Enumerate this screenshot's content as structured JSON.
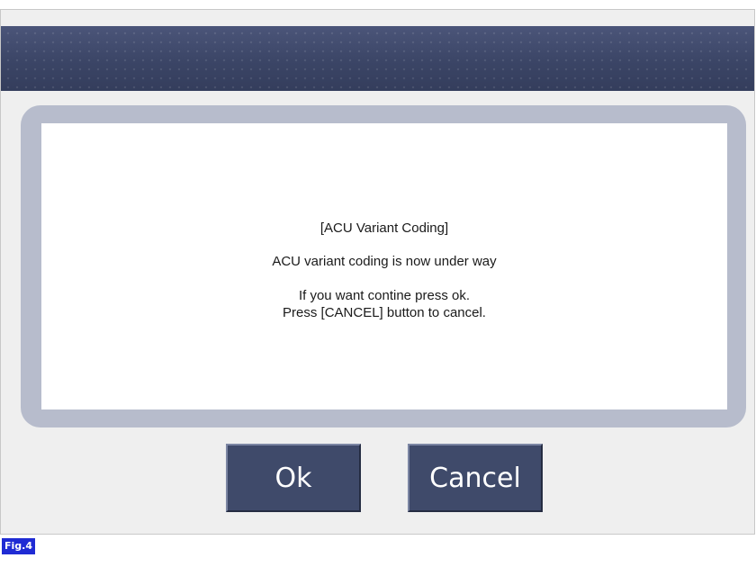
{
  "dialog": {
    "message_title": "[ACU Variant Coding]",
    "message_line": "ACU variant coding is now under way",
    "instruction_line1": "If you want contine press ok.",
    "instruction_line2": "Press [CANCEL] button to cancel."
  },
  "buttons": {
    "ok_label": "Ok",
    "cancel_label": "Cancel"
  },
  "figure_label": "Fig.4",
  "colors": {
    "title_bar": "#3d4769",
    "button": "#3f4a6a",
    "panel_border": "#b7bccc",
    "figure_label_bg": "#1f2bd4"
  }
}
